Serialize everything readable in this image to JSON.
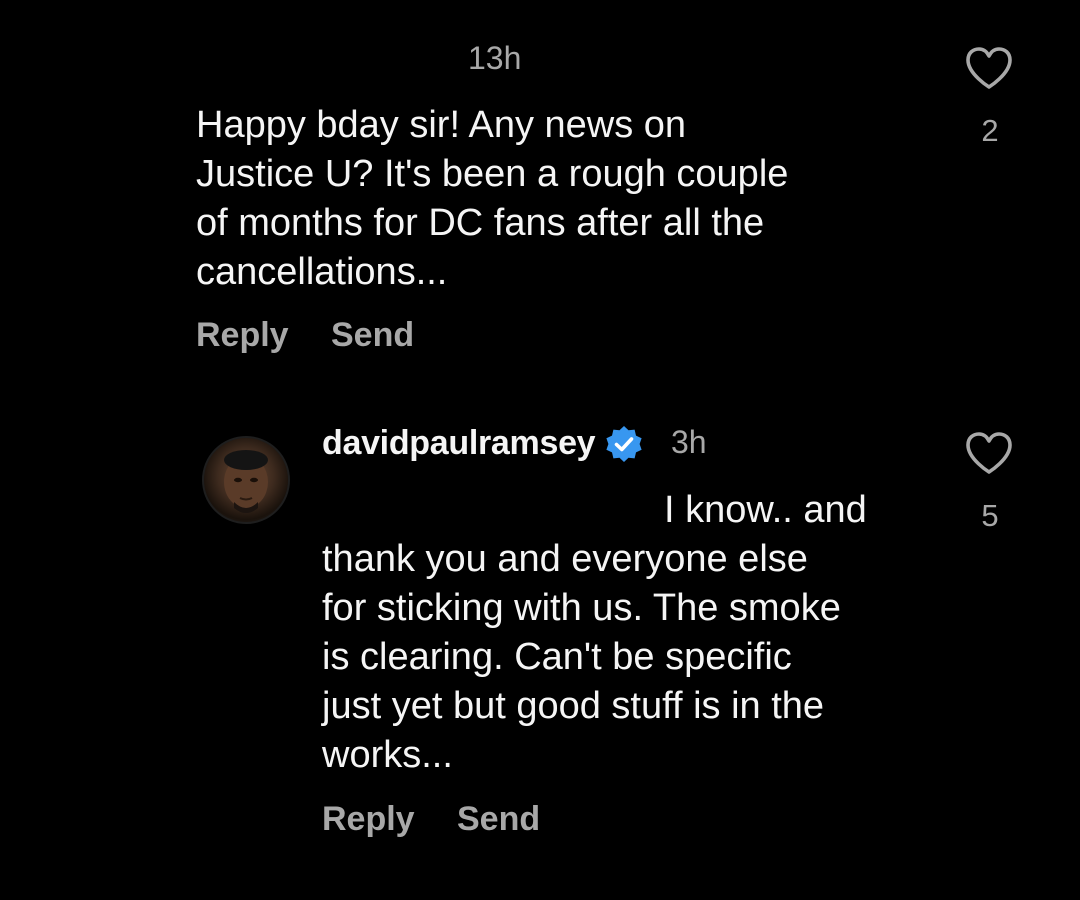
{
  "comment1": {
    "time": "13h",
    "text_lines": [
      "Happy bday sir! Any news on",
      "Justice U? It's been a rough couple",
      "of months for DC fans after all the",
      "cancellations..."
    ],
    "reply_label": "Reply",
    "send_label": "Send",
    "likes": "2",
    "like_icon": "heart-outline-icon"
  },
  "comment2": {
    "username": "davidpaulramsey",
    "verified_icon": "verified-badge-icon",
    "verified_color": "#3897f0",
    "time": "3h",
    "text_lines": [
      "I know.. and",
      "thank you and everyone else",
      "for sticking with us. The smoke",
      "is clearing. Can't be specific",
      "just yet but good stuff is in the",
      "works..."
    ],
    "reply_label": "Reply",
    "send_label": "Send",
    "likes": "5",
    "like_icon": "heart-outline-icon"
  }
}
